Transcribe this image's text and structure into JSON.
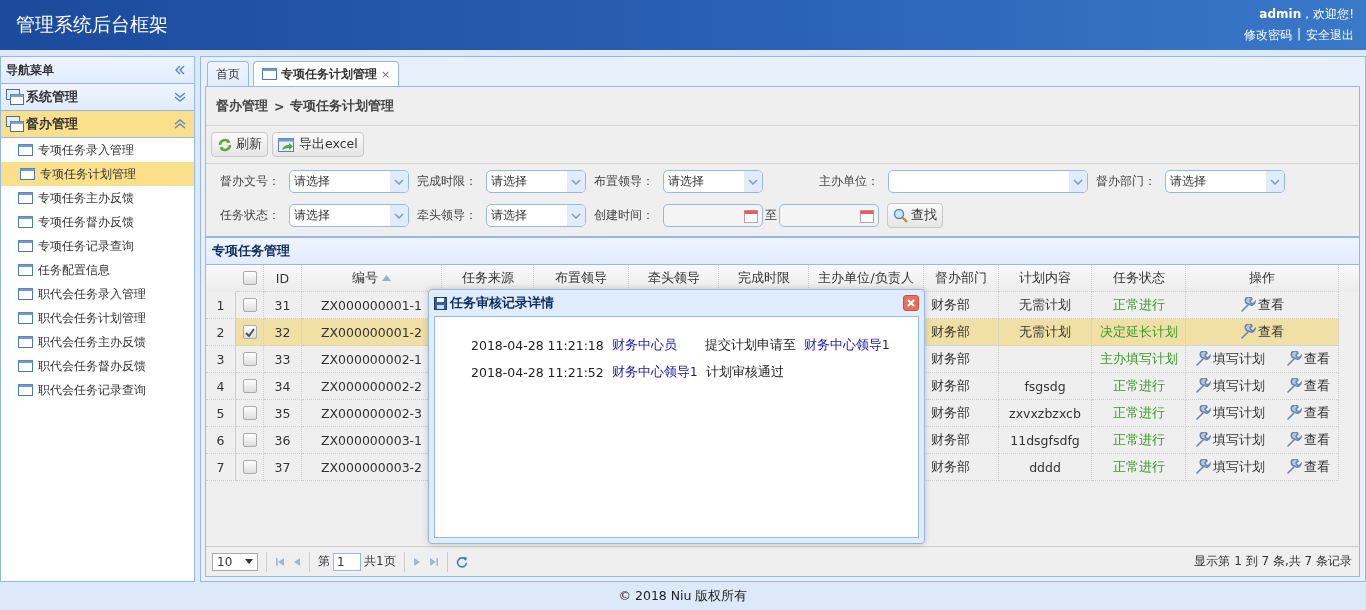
{
  "header": {
    "title": "管理系统后台框架",
    "welcome": "**admin**，欢迎您!",
    "links": [
      "修改密码",
      "安全退出"
    ],
    "separator": "|"
  },
  "nav": {
    "title": "导航菜单",
    "groups": [
      {
        "label": "系统管理",
        "expanded": false
      },
      {
        "label": "督办管理",
        "expanded": true,
        "children": [
          {
            "label": "专项任务录入管理",
            "selected": false
          },
          {
            "label": "专项任务计划管理",
            "selected": true
          },
          {
            "label": "专项任务主办反馈",
            "selected": false
          },
          {
            "label": "专项任务督办反馈",
            "selected": false
          },
          {
            "label": "专项任务记录查询",
            "selected": false
          },
          {
            "label": "任务配置信息",
            "selected": false
          },
          {
            "label": "职代会任务录入管理",
            "selected": false
          },
          {
            "label": "职代会任务计划管理",
            "selected": false
          },
          {
            "label": "职代会任务主办反馈",
            "selected": false
          },
          {
            "label": "职代会任务督办反馈",
            "selected": false
          },
          {
            "label": "职代会任务记录查询",
            "selected": false
          }
        ]
      }
    ]
  },
  "tabs": [
    {
      "label": "首页",
      "selected": false,
      "closable": false
    },
    {
      "label": "专项任务计划管理",
      "selected": true,
      "closable": true,
      "close": "×"
    }
  ],
  "breadcrumb": [
    "督办管理",
    "专项任务计划管理"
  ],
  "breadcrumb_separator": ">",
  "toolbar": [
    {
      "kind": "refresh",
      "label": "刷新"
    },
    {
      "kind": "export",
      "label": "导出excel"
    }
  ],
  "filters": [
    [
      {
        "kind": "select",
        "label": "督办文号：",
        "value": "请选择"
      },
      {
        "kind": "select",
        "label": "完成时限：",
        "value": "请选择"
      },
      {
        "kind": "select",
        "label": "布置领导：",
        "value": "请选择"
      },
      {
        "kind": "select",
        "label": "主办单位："
      },
      {
        "kind": "select",
        "label": "督办部门：",
        "value": "请选择"
      }
    ],
    [
      {
        "kind": "select",
        "label": "任务状态：",
        "value": "请选择"
      },
      {
        "kind": "select",
        "label": "牵头领导：",
        "value": "请选择"
      },
      {
        "kind": "daterange",
        "label": "创建时间：",
        "to": "至"
      },
      {
        "kind": "button",
        "label": "查找"
      }
    ]
  ],
  "grid": {
    "title": "专项任务管理",
    "header_checked": false,
    "columns": [
      {
        "label": "ID",
        "sorted": false
      },
      {
        "label": "编号",
        "sorted": true
      },
      {
        "label": "任务来源",
        "sorted": false
      },
      {
        "label": "布置领导",
        "sorted": false
      },
      {
        "label": "牵头领导",
        "sorted": false
      },
      {
        "label": "完成时限",
        "sorted": false
      },
      {
        "label": "主办单位/负责人",
        "sorted": false
      },
      {
        "label": "督办部门",
        "sorted": false
      },
      {
        "label": "计划内容",
        "sorted": false
      },
      {
        "label": "任务状态",
        "sorted": false
      },
      {
        "label": "操作",
        "sorted": false
      }
    ],
    "rows": [
      {
        "num": "1",
        "checked": false,
        "selected": false,
        "id": "31",
        "code": "ZX000000001-1",
        "dept": "财务部",
        "plan": "无需计划",
        "status": "正常进行",
        "actions": [
          "查看"
        ]
      },
      {
        "num": "2",
        "checked": true,
        "selected": true,
        "id": "32",
        "code": "ZX000000001-2",
        "dept": "财务部",
        "plan": "无需计划",
        "status": "决定延长计划",
        "actions": [
          "查看"
        ]
      },
      {
        "num": "3",
        "checked": false,
        "selected": false,
        "id": "33",
        "code": "ZX000000002-1",
        "dept": "财务部",
        "plan": "",
        "status": "主办填写计划",
        "actions": [
          "填写计划",
          "查看"
        ]
      },
      {
        "num": "4",
        "checked": false,
        "selected": false,
        "id": "34",
        "code": "ZX000000002-2",
        "dept": "财务部",
        "plan": "fsgsdg",
        "status": "正常进行",
        "actions": [
          "填写计划",
          "查看"
        ]
      },
      {
        "num": "5",
        "checked": false,
        "selected": false,
        "id": "35",
        "code": "ZX000000002-3",
        "dept": "财务部",
        "plan": "zxvxzbzxcb",
        "status": "正常进行",
        "actions": [
          "填写计划",
          "查看"
        ]
      },
      {
        "num": "6",
        "checked": false,
        "selected": false,
        "id": "36",
        "code": "ZX000000003-1",
        "dept": "财务部",
        "plan": "11dsgfsdfg",
        "status": "正常进行",
        "actions": [
          "填写计划",
          "查看"
        ]
      },
      {
        "num": "7",
        "checked": false,
        "selected": false,
        "id": "37",
        "code": "ZX000000003-2",
        "dept": "财务部",
        "plan": "dddd",
        "status": "正常进行",
        "actions": [
          "填写计划",
          "查看"
        ]
      }
    ],
    "pager": {
      "page_size": "10",
      "page_label": "第",
      "page": "1",
      "total_pages": "共1页",
      "summary": "显示第 1 到 7 条,共 7 条记录"
    }
  },
  "dialog": {
    "title": "任务审核记录详情",
    "records": [
      {
        "time": "2018-04-28 11:21:18",
        "actor": "财务中心员",
        "action": "提交计划申请至",
        "target": "财务中心领导1"
      },
      {
        "time": "2018-04-28 11:21:52",
        "actor": "财务中心领导1",
        "action": "计划审核通过"
      }
    ]
  },
  "footer": "© 2018 Niu 版权所有"
}
